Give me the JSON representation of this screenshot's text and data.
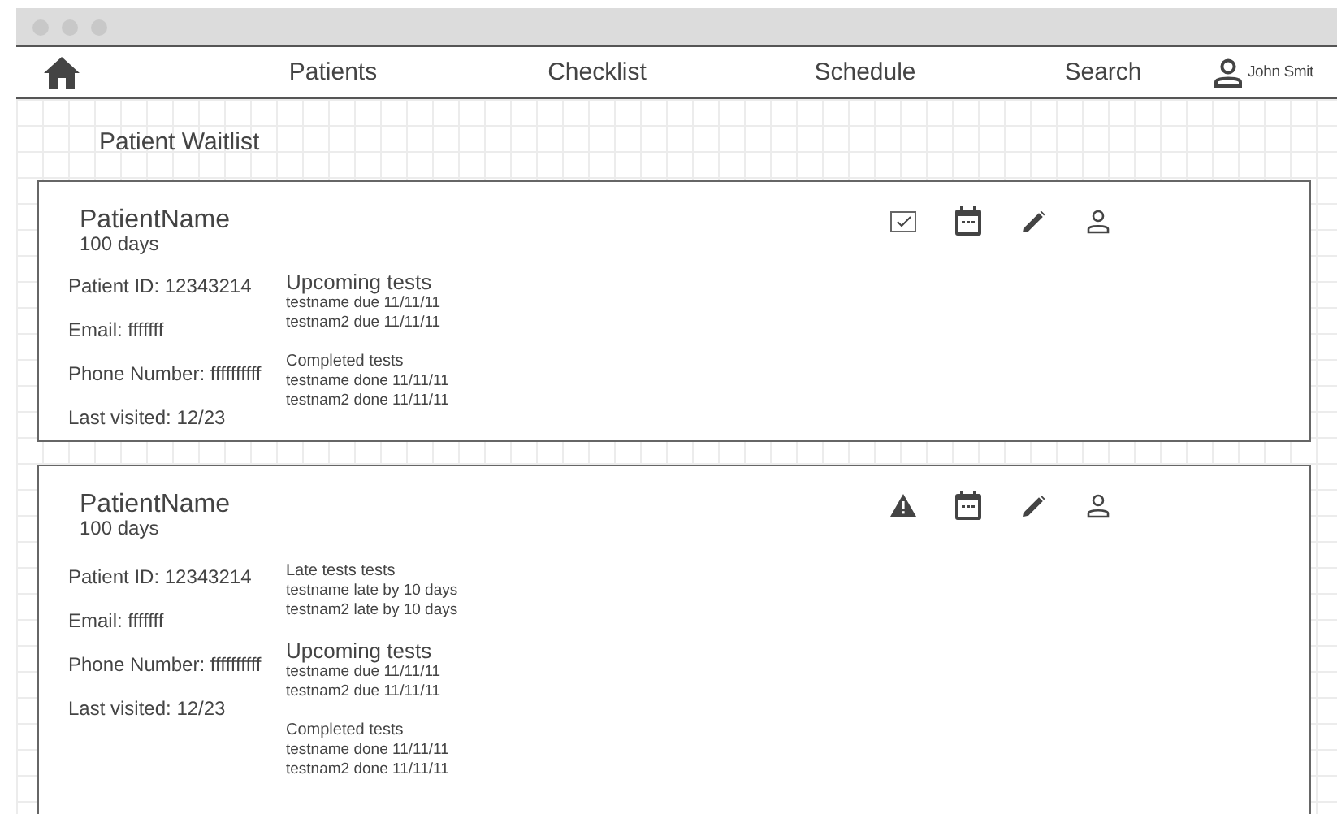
{
  "nav": {
    "items": [
      {
        "label": "Patients"
      },
      {
        "label": "Checklist"
      },
      {
        "label": "Schedule"
      },
      {
        "label": "Search"
      }
    ],
    "user": "John Smit"
  },
  "page_title": "Patient Waitlist",
  "patients": [
    {
      "name": "PatientName",
      "days": "100 days",
      "status": {
        "kind": "checkbox",
        "checked": true
      },
      "info": [
        "Patient ID: 12343214",
        "Email: fffffff",
        "Phone Number: ffffffffff",
        "Last visited: 12/23"
      ],
      "tests": [
        {
          "kind": "upcoming",
          "heading": "Upcoming tests",
          "items": [
            "testname due 11/11/11",
            "testnam2 due 11/11/11"
          ]
        },
        {
          "kind": "completed",
          "heading": "Completed tests",
          "items": [
            "testname done 11/11/11",
            "testnam2 done 11/11/11"
          ]
        }
      ]
    },
    {
      "name": "PatientName",
      "days": "100 days",
      "status": {
        "kind": "warning"
      },
      "info": [
        "Patient ID: 12343214",
        "Email: fffffff",
        "Phone Number: ffffffffff",
        "Last visited: 12/23"
      ],
      "tests": [
        {
          "kind": "late",
          "heading": "Late tests tests",
          "items": [
            "testname late by 10 days",
            "testnam2 late by 10 days"
          ]
        },
        {
          "kind": "upcoming",
          "heading": "Upcoming tests",
          "items": [
            "testname due 11/11/11",
            "testnam2 due 11/11/11"
          ]
        },
        {
          "kind": "completed",
          "heading": "Completed tests",
          "items": [
            "testname done 11/11/11",
            "testnam2 done 11/11/11"
          ]
        }
      ]
    }
  ]
}
